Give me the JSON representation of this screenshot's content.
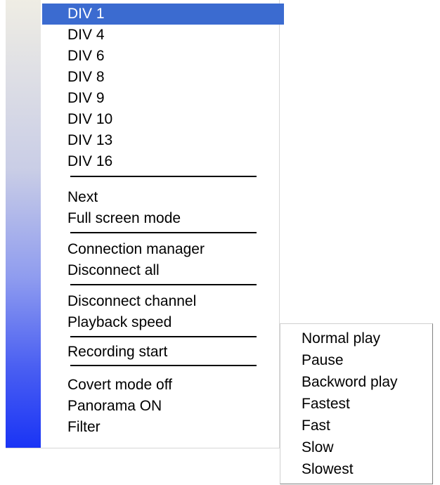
{
  "menu": {
    "items": [
      {
        "label": "DIV 1",
        "selected": true
      },
      {
        "label": "DIV 4"
      },
      {
        "label": "DIV 6"
      },
      {
        "label": "DIV 8"
      },
      {
        "label": "DIV 9"
      },
      {
        "label": "DIV 10"
      },
      {
        "label": "DIV 13"
      },
      {
        "label": "DIV 16"
      },
      {
        "label": "Next"
      },
      {
        "label": "Full screen mode"
      },
      {
        "label": "Connection manager"
      },
      {
        "label": "Disconnect all"
      },
      {
        "label": "Disconnect channel"
      },
      {
        "label": "Playback speed"
      },
      {
        "label": "Recording start"
      },
      {
        "label": "Covert mode off"
      },
      {
        "label": "Panorama ON"
      },
      {
        "label": "Filter"
      }
    ]
  },
  "submenu": {
    "items": [
      {
        "label": "Normal play"
      },
      {
        "label": "Pause"
      },
      {
        "label": "Backword play"
      },
      {
        "label": "Fastest"
      },
      {
        "label": "Fast"
      },
      {
        "label": "Slow"
      },
      {
        "label": "Slowest"
      }
    ]
  },
  "colors": {
    "selection": "#3b6bd0",
    "sidebar_top": "#efede4",
    "sidebar_bottom": "#1a34f5"
  }
}
